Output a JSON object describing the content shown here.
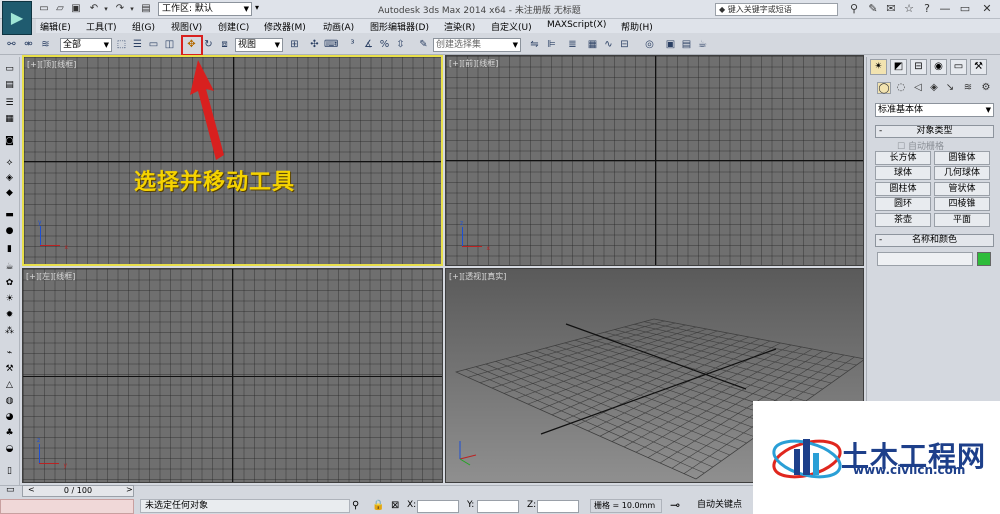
{
  "title_bar": {
    "workspace_label": "工作区: 默认",
    "window_title": "Autodesk 3ds Max  2014 x64  - 未注册版   无标题",
    "search_placeholder": "键入关键字或短语"
  },
  "menu": [
    "编辑(E)",
    "工具(T)",
    "组(G)",
    "视图(V)",
    "创建(C)",
    "修改器(M)",
    "动画(A)",
    "图形编辑器(D)",
    "渲染(R)",
    "自定义(U)",
    "MAXScript(X)",
    "帮助(H)"
  ],
  "toolbar": {
    "filter_value": "全部",
    "coord_value": "视图",
    "selection_set_placeholder": "创建选择集"
  },
  "viewports": {
    "top_label": "[+][顶][线框]",
    "front_label": "[+][前][线框]",
    "left_label": "[+][左][线框]",
    "persp_label": "[+][透视][真实]"
  },
  "annotation": "选择并移动工具",
  "command_panel": {
    "category_value": "标准基本体",
    "object_type_title": "对象类型",
    "autogrid_label": "自动栅格",
    "object_types": [
      "长方体",
      "圆锥体",
      "球体",
      "几何球体",
      "圆柱体",
      "管状体",
      "圆环",
      "四棱锥",
      "茶壶",
      "平面"
    ],
    "name_color_title": "名称和颜色",
    "color_swatch": "#2ebc3a"
  },
  "status": {
    "timeline_counter": "0 / 100",
    "message": "未选定任何对象",
    "x_label": "X:",
    "y_label": "Y:",
    "z_label": "Z:",
    "grid_label": "栅格 = 10.0mm",
    "autokey_label": "自动关键点"
  },
  "watermark": {
    "name": "土木工程网",
    "url": "www.civilcn.com"
  },
  "colors": {
    "highlight": "#d8201f",
    "annotation_text": "#f5d300",
    "active_viewport_border": "#e8df4a"
  }
}
